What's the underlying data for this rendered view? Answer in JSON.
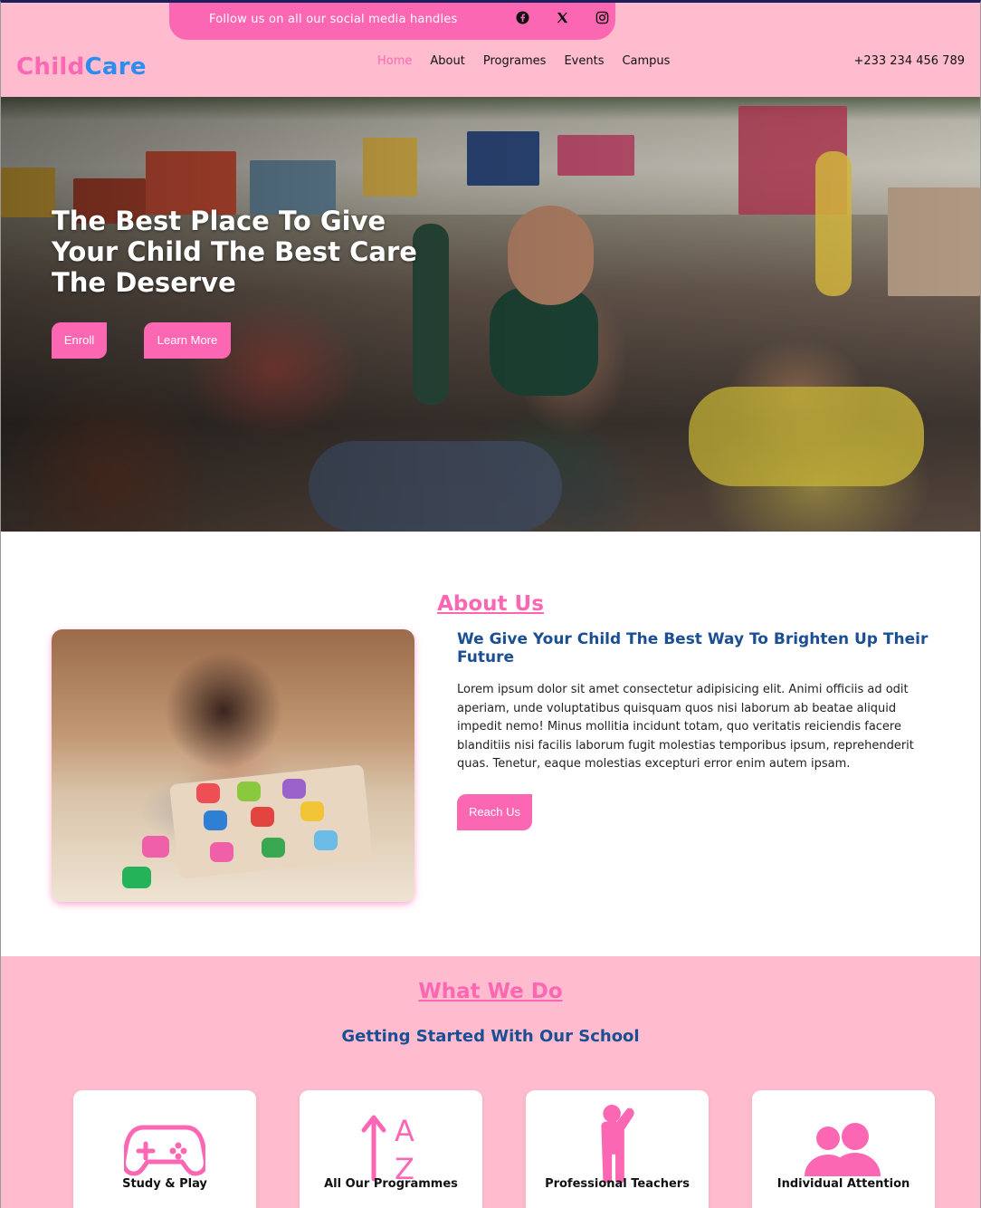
{
  "topbar": {
    "follow_text": "Follow us on all our social media handles",
    "social": [
      "facebook-icon",
      "x-icon",
      "instagram-icon"
    ]
  },
  "logo": {
    "part1": "Child",
    "part2": "Care"
  },
  "nav": {
    "items": [
      "Home",
      "About",
      "Programes",
      "Events",
      "Campus"
    ],
    "active": "Home"
  },
  "phone": "+233 234 456 789",
  "hero": {
    "heading": "The Best Place To Give Your Child The Best Care The Deserve",
    "enroll_label": "Enroll",
    "learn_label": "Learn More"
  },
  "about": {
    "title": "About Us",
    "subtitle": "We Give Your Child The Best Way To Brighten Up Their Future",
    "text": "Lorem ipsum dolor sit amet consectetur adipisicing elit. Animi officiis ad odit aperiam, unde voluptatibus quisquam quos nisi laborum ab beatae aliquid impedit nemo! Minus mollitia incidunt totam, quo veritatis reiciendis facere blanditiis nisi facilis laborum fugit molestias temporibus ipsum, reprehenderit quas. Tenetur, eaque molestias excepturi error enim autem ipsam.",
    "button": "Reach Us"
  },
  "what_we_do": {
    "title": "What We Do",
    "subtitle": "Getting Started With Our School",
    "cards": [
      {
        "icon": "gamepad-icon",
        "label": "Study & Play"
      },
      {
        "icon": "sort-az-icon",
        "label": "All Our Programmes"
      },
      {
        "icon": "person-raising-hand-icon",
        "label": "Professional Teachers"
      },
      {
        "icon": "users-icon",
        "label": "Individual Attention"
      }
    ]
  },
  "colors": {
    "accent": "#fc67b4",
    "background_pink": "#ffbcce",
    "heading_navy": "#1b4f93",
    "logo_blue": "#2c8cf0"
  }
}
